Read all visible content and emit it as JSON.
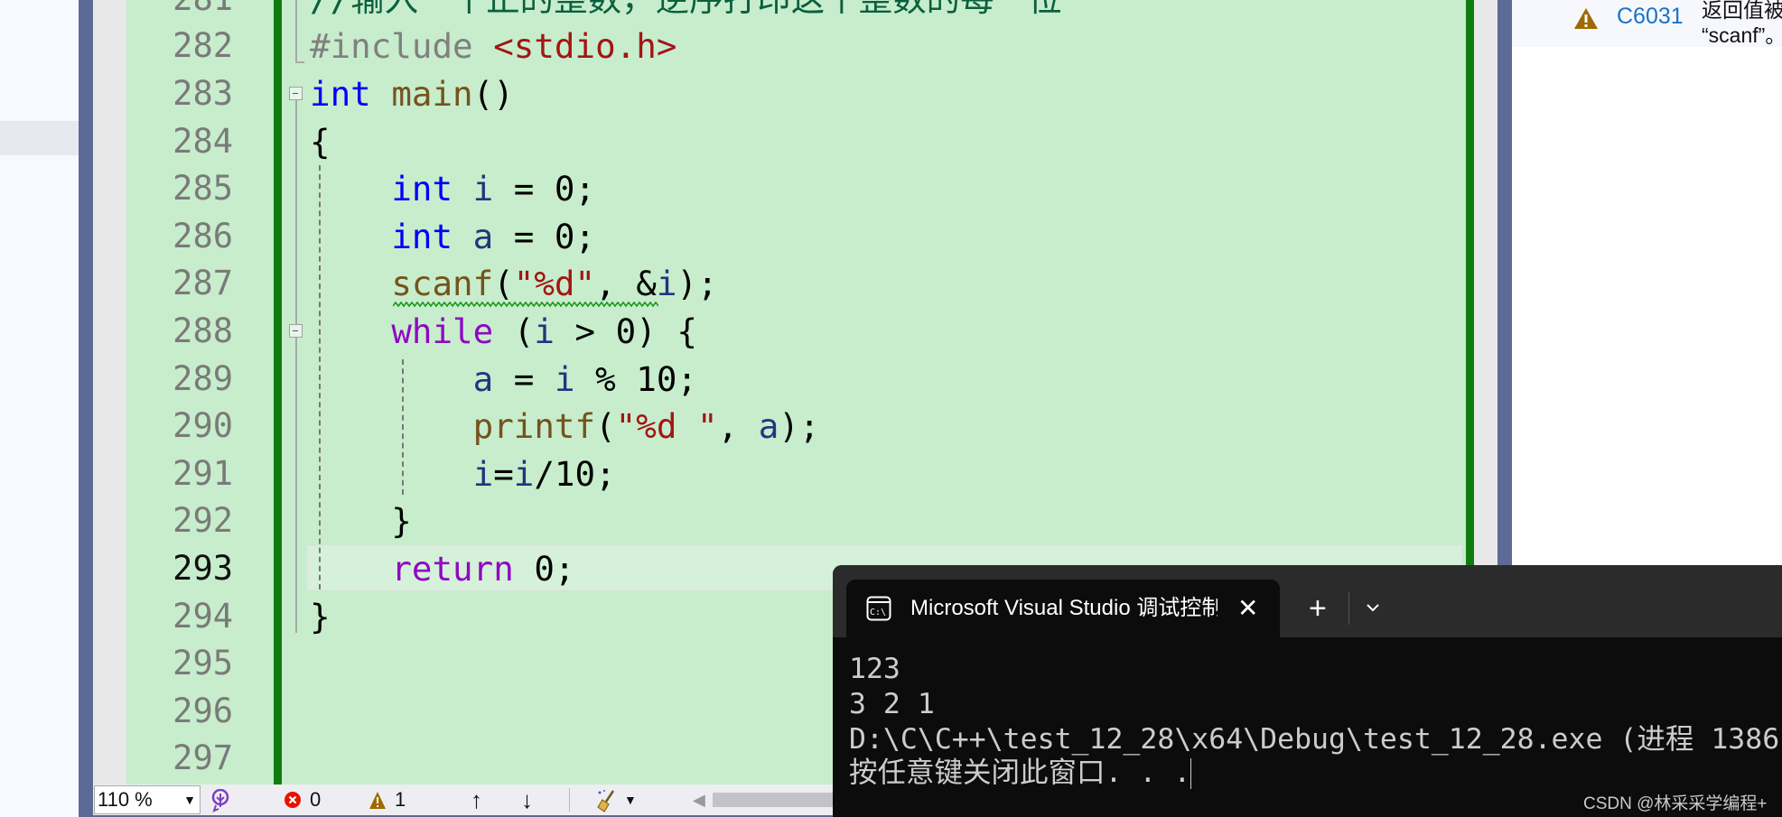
{
  "editor": {
    "current_line": 293,
    "lines": [
      {
        "n": "281",
        "tokens": [
          {
            "t": "//输入一个正的整数，逆序打印这个整数的每一位",
            "c": "cm"
          }
        ]
      },
      {
        "n": "282",
        "tokens": [
          {
            "t": "#include ",
            "c": "pp"
          },
          {
            "t": "<stdio.h>",
            "c": "inc"
          }
        ]
      },
      {
        "n": "283",
        "tokens": [
          {
            "t": "int",
            "c": "kw"
          },
          {
            "t": " ",
            "c": ""
          },
          {
            "t": "main",
            "c": "fn"
          },
          {
            "t": "()",
            "c": ""
          }
        ]
      },
      {
        "n": "284",
        "tokens": [
          {
            "t": "{",
            "c": ""
          }
        ]
      },
      {
        "n": "285",
        "tokens": [
          {
            "t": "    ",
            "c": ""
          },
          {
            "t": "int",
            "c": "kw"
          },
          {
            "t": " ",
            "c": ""
          },
          {
            "t": "i",
            "c": "var"
          },
          {
            "t": " = 0;",
            "c": ""
          }
        ]
      },
      {
        "n": "286",
        "tokens": [
          {
            "t": "    ",
            "c": ""
          },
          {
            "t": "int",
            "c": "kw"
          },
          {
            "t": " ",
            "c": ""
          },
          {
            "t": "a",
            "c": "var"
          },
          {
            "t": " = 0;",
            "c": ""
          }
        ]
      },
      {
        "n": "287",
        "tokens": [
          {
            "t": "    ",
            "c": ""
          },
          {
            "t": "scanf",
            "c": "fn"
          },
          {
            "t": "(",
            "c": ""
          },
          {
            "t": "\"%d\"",
            "c": "str"
          },
          {
            "t": ", &",
            "c": ""
          },
          {
            "t": "i",
            "c": "var"
          },
          {
            "t": ");",
            "c": ""
          }
        ]
      },
      {
        "n": "288",
        "tokens": [
          {
            "t": "    ",
            "c": ""
          },
          {
            "t": "while",
            "c": "ctl"
          },
          {
            "t": " (",
            "c": ""
          },
          {
            "t": "i",
            "c": "var"
          },
          {
            "t": " > 0) {",
            "c": ""
          }
        ]
      },
      {
        "n": "289",
        "tokens": [
          {
            "t": "        ",
            "c": ""
          },
          {
            "t": "a",
            "c": "var"
          },
          {
            "t": " = ",
            "c": ""
          },
          {
            "t": "i",
            "c": "var"
          },
          {
            "t": " % 10;",
            "c": ""
          }
        ]
      },
      {
        "n": "290",
        "tokens": [
          {
            "t": "        ",
            "c": ""
          },
          {
            "t": "printf",
            "c": "fn"
          },
          {
            "t": "(",
            "c": ""
          },
          {
            "t": "\"%d \"",
            "c": "str"
          },
          {
            "t": ", ",
            "c": ""
          },
          {
            "t": "a",
            "c": "var"
          },
          {
            "t": ");",
            "c": ""
          }
        ]
      },
      {
        "n": "291",
        "tokens": [
          {
            "t": "        ",
            "c": ""
          },
          {
            "t": "i",
            "c": "var"
          },
          {
            "t": "=",
            "c": ""
          },
          {
            "t": "i",
            "c": "var"
          },
          {
            "t": "/10;",
            "c": ""
          }
        ]
      },
      {
        "n": "292",
        "tokens": [
          {
            "t": "    }",
            "c": ""
          }
        ]
      },
      {
        "n": "293",
        "tokens": [
          {
            "t": "    ",
            "c": ""
          },
          {
            "t": "return",
            "c": "ctl"
          },
          {
            "t": " 0;",
            "c": ""
          }
        ]
      },
      {
        "n": "294",
        "tokens": [
          {
            "t": "}",
            "c": ""
          }
        ]
      },
      {
        "n": "295",
        "tokens": []
      },
      {
        "n": "296",
        "tokens": []
      },
      {
        "n": "297",
        "tokens": []
      }
    ]
  },
  "error_list": {
    "code": "C6031",
    "severity_icon": "warning-icon",
    "message_line1": "返回值被",
    "message_line2": "“scanf”。"
  },
  "status_bar": {
    "zoom": "110 %",
    "errors": "0",
    "warnings": "1"
  },
  "terminal": {
    "tab_title": "Microsoft Visual Studio 调试控制台",
    "output": [
      "123",
      "3 2 1",
      "D:\\C\\C++\\test_12_28\\x64\\Debug\\test_12_28.exe (进程 1386",
      "按任意键关闭此窗口. . ."
    ]
  },
  "watermark": "CSDN @林采采学编程+",
  "colors": {
    "editor_bg": "#c7edcc",
    "change_bar": "#107c10",
    "keyword": "#0000ff",
    "control": "#8f08c4",
    "function": "#74531f",
    "string": "#a31515",
    "variable": "#1f377f",
    "terminal_bg": "#0c0c0c"
  }
}
